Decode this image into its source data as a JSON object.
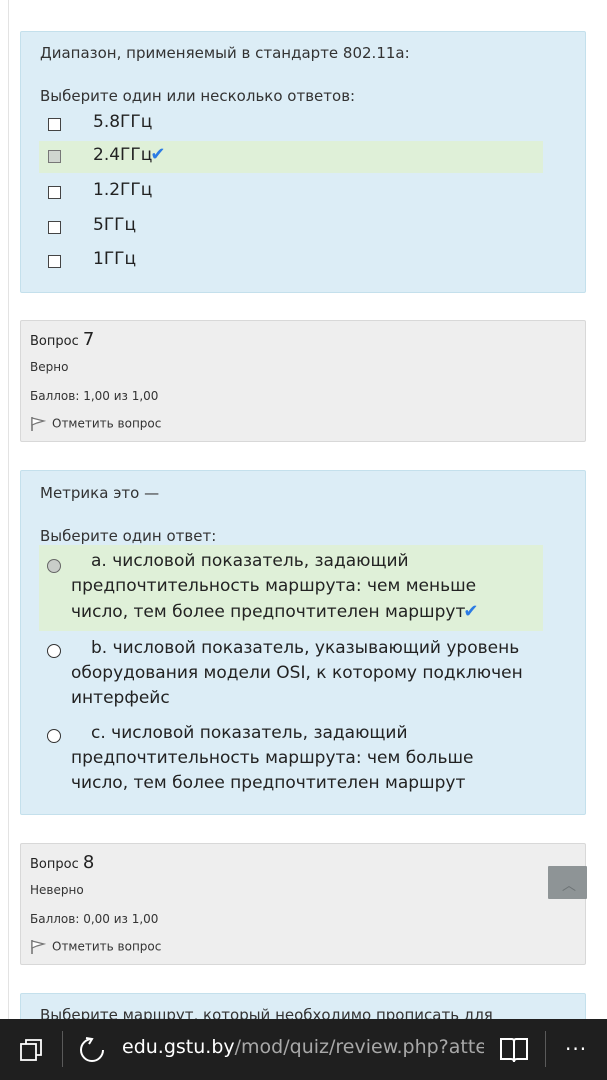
{
  "question6": {
    "text": "Диапазон, применяемый в стандарте 802.11a:",
    "prompt": "Выберите один или несколько ответов:",
    "options": [
      {
        "label": "5.8ГГц",
        "checked": false,
        "correct": false
      },
      {
        "label": "2.4ГГц",
        "checked": true,
        "correct": true
      },
      {
        "label": "1.2ГГц",
        "checked": false,
        "correct": false
      },
      {
        "label": "5ГГц",
        "checked": false,
        "correct": false
      },
      {
        "label": "1ГГц",
        "checked": false,
        "correct": false
      }
    ]
  },
  "info7": {
    "title": "Вопрос",
    "number": "7",
    "state": "Верно",
    "grade": "Баллов: 1,00 из 1,00",
    "flag": "Отметить вопрос"
  },
  "question7": {
    "text": "Метрика это —",
    "prompt": "Выберите один ответ:",
    "options": [
      {
        "label": "a. числовой показатель, задающий предпочтительность маршрута: чем меньше число, тем более предпочтителен маршрут",
        "checked": true,
        "correct": true
      },
      {
        "label": "b. числовой показатель, указывающий уровень оборудования модели OSI, к которому подключен интерфейс",
        "checked": false,
        "correct": false
      },
      {
        "label": "c. числовой показатель, задающий предпочтительность маршрута: чем больше число, тем более предпочтителен маршрут",
        "checked": false,
        "correct": false
      }
    ]
  },
  "info8": {
    "title": "Вопрос",
    "number": "8",
    "state": "Неверно",
    "grade": "Баллов: 0,00 из 1,00",
    "flag": "Отметить вопрос"
  },
  "question8": {
    "text": "Выберите маршрут, который необходимо прописать для"
  },
  "browser": {
    "url_domain": "edu.gstu.by",
    "url_path": "/mod/quiz/review.php?attempt=",
    "more": "···"
  },
  "icons": {
    "tick": "checkmark-icon",
    "flag": "flag-icon",
    "scroll": "chevron-up-icon",
    "tabs": "tabs-icon",
    "refresh": "refresh-icon",
    "reading": "reading-view-icon",
    "more": "more-icon"
  }
}
